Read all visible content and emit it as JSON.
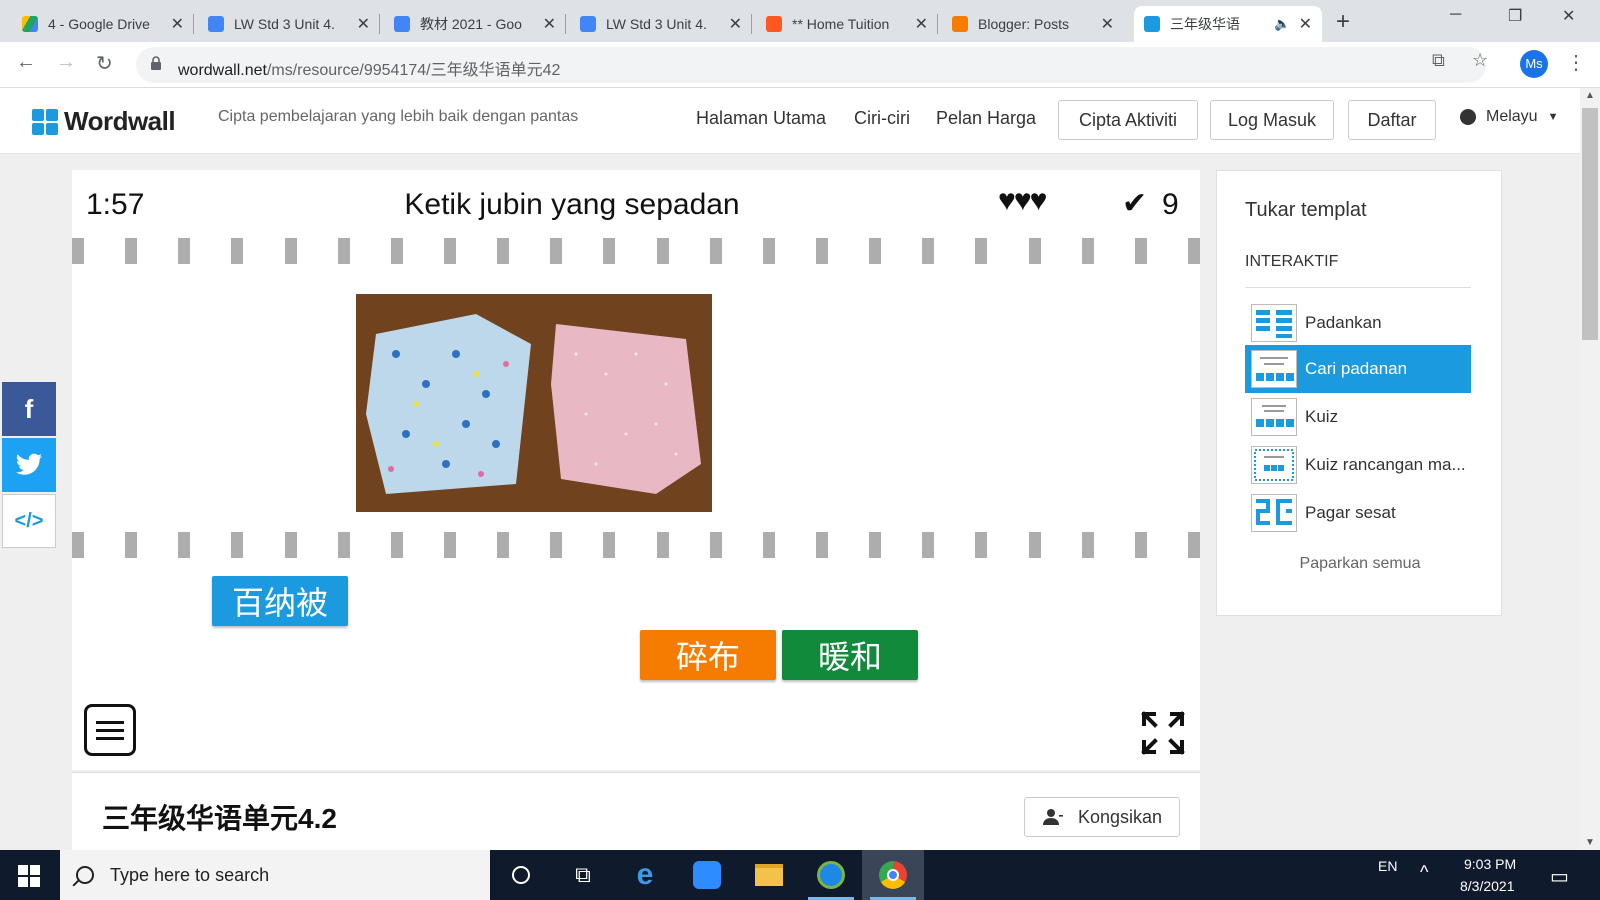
{
  "browser": {
    "tabs": [
      {
        "label": "4 - Google Drive",
        "icon": "google-drive-icon",
        "color": "#1fa463"
      },
      {
        "label": "LW Std 3 Unit 4.",
        "icon": "google-docs-icon",
        "color": "#4285f4"
      },
      {
        "label": "教材 2021 - Goo",
        "icon": "google-docs-icon",
        "color": "#4285f4"
      },
      {
        "label": "LW Std 3 Unit 4.",
        "icon": "google-docs-icon",
        "color": "#4285f4"
      },
      {
        "label": "** Home Tuition",
        "icon": "blogger-icon",
        "color": "#ff5722"
      },
      {
        "label": "Blogger: Posts",
        "icon": "blogger-icon",
        "color": "#f57c00"
      },
      {
        "label": "三年级华语",
        "icon": "wordwall-icon",
        "color": "#1b9ae0",
        "active": true
      }
    ],
    "url_host": "wordwall.net",
    "url_path": "/ms/resource/9954174/三年级华语单元42",
    "profile_initials": "Ms"
  },
  "site": {
    "logo": "Wordwall",
    "tagline": "Cipta pembelajaran yang lebih baik dengan pantas",
    "nav": [
      "Halaman Utama",
      "Ciri-ciri",
      "Pelan Harga"
    ],
    "buttons": [
      "Cipta Aktiviti",
      "Log Masuk",
      "Daftar"
    ],
    "language": "Melayu"
  },
  "game": {
    "timer": "1:57",
    "title": "Ketik jubin yang sepadan",
    "lives": "♥♥♥",
    "score": "9",
    "tiles": [
      {
        "text": "百纳被",
        "color": "#1b9ae0"
      },
      {
        "text": "碎布",
        "color": "#f57c00"
      },
      {
        "text": "暖和",
        "color": "#128a3c"
      }
    ]
  },
  "sidebar": {
    "title": "Tukar templat",
    "section": "INTERAKTIF",
    "templates": [
      "Padankan",
      "Cari padanan",
      "Kuiz",
      "Kuiz rancangan ma...",
      "Pagar sesat"
    ],
    "selected": "Cari padanan",
    "show_all": "Paparkan semua"
  },
  "activity": {
    "title": "三年级华语单元4.2",
    "share": "Kongsikan"
  },
  "taskbar": {
    "search_placeholder": "Type here to search",
    "lang": "EN",
    "time": "9:03 PM",
    "date": "8/3/2021"
  },
  "colors": {
    "accent": "#1b9ae0",
    "facebook": "#3b5998",
    "twitter": "#1da1f2"
  }
}
